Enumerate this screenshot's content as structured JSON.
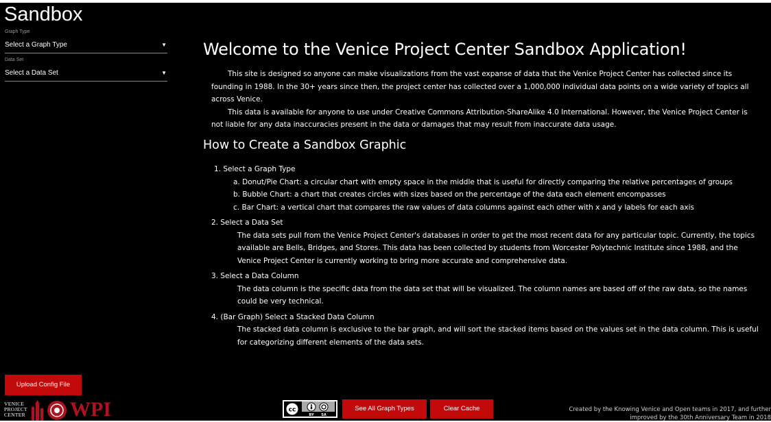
{
  "sidebar": {
    "title": "Sandbox",
    "graph_type_label": "Graph Type",
    "graph_type_value": "Select a Graph Type",
    "data_set_label": "Data Set",
    "data_set_value": "Select a Data Set",
    "dropdown_arrow": "▼",
    "upload_label": "Upload Config File",
    "logo_vpc": [
      "VENICE",
      "PROJECT",
      "CENTER"
    ],
    "logo_wpi": "WPI"
  },
  "main": {
    "welcome_title": "Welcome to the Venice Project Center Sandbox Application!",
    "intro_p1": "This site is designed so anyone can make visualizations from the vast expanse of data that the Venice Project Center has collected since its founding in 1988. In the 30+ years since then, the project center has collected over a 1,000,000 individual data points on a wide variety of topics all across Venice.",
    "intro_p2": "This data is available for anyone to use under Creative Commons Attribution-ShareAlike 4.0 International. However, the Venice Project Center is not liable for any data inaccuracies present in the data or damages that may result from inaccurate data usage.",
    "howto_title": "How to Create a Sandbox Graphic",
    "step1_title": "1. Select a Graph Type",
    "step1_a": "a. Donut/Pie Chart: a circular chart with empty space in the middle that is useful for directly comparing the relative percentages of groups",
    "step1_b": "b. Bubble Chart: a chart that creates circles with sizes based on the percentage of the data each element encompasses",
    "step1_c": "c. Bar Chart: a vertical chart that compares the raw values of data columns against each other with x and y labels for each axis",
    "step2_title": "2. Select a Data Set",
    "step2_desc": "The data sets pull from the Venice Project Center's databases in order to get the most recent data for any particular topic. Currently, the topics available are Bells, Bridges, and Stores. This data has been collected by students from Worcester Polytechnic Institute since 1988, and the Venice Project Center is currently working to bring more accurate and comprehensive data.",
    "step3_title": "3. Select a Data Column",
    "step3_desc": "The data column is the specific data from the data set that will be visualized. The column names are based off of the raw data, so the names could be very technical.",
    "step4_title": "4. (Bar Graph) Select a Stacked Data Column",
    "step4_desc": "The stacked data column is exclusive to the bar graph, and will sort the stacked items based on the values set in the data column. This is useful for categorizing different elements of the data sets."
  },
  "footer": {
    "cc_cc": "cc",
    "cc_by": "BY",
    "cc_sa": "SA",
    "see_all_label": "See All Graph Types",
    "clear_cache_label": "Clear Cache",
    "credit_line1": "Created by the Knowing Venice and Open teams in 2017, and further",
    "credit_line2": "improved by the 30th Anniversary Team in 2018"
  },
  "colors": {
    "background": "#000000",
    "accent_red": "#c30a0a",
    "wpi_red": "#ae1420"
  }
}
